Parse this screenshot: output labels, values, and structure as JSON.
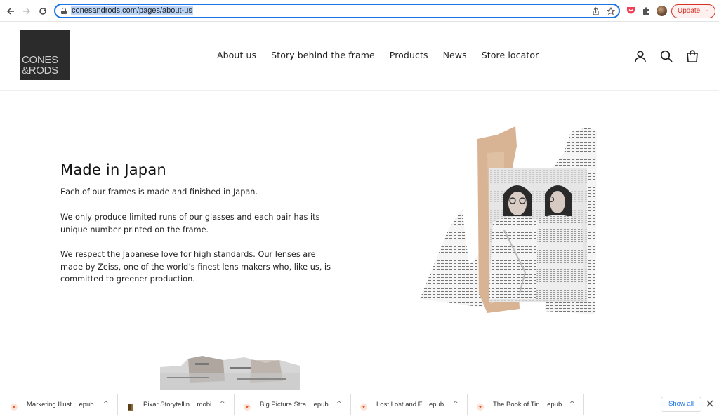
{
  "browser": {
    "url": "conesandrods.com/pages/about-us",
    "update_label": "Update",
    "menu_glyph": "⋮"
  },
  "site": {
    "logo_line1": "CONES",
    "logo_line2": "&RODS",
    "nav": [
      "About us",
      "Story behind the frame",
      "Products",
      "News",
      "Store locator"
    ]
  },
  "main": {
    "heading": "Made in Japan",
    "paragraphs": [
      "Each of our frames is made and finished in Japan.",
      "We only produce limited runs of our glasses and each pair has its unique number printed on the frame.",
      "We respect the Japanese love for high standards. Our lenses are made by Zeiss, one of the world’s finest lens makers who, like us, is committed to greener production."
    ]
  },
  "downloads": {
    "items": [
      {
        "label": "Marketing Illust....epub",
        "icon": "epub-icon"
      },
      {
        "label": "Pixar Storytellin....mobi",
        "icon": "mobi-icon"
      },
      {
        "label": "Big Picture Stra....epub",
        "icon": "epub-icon"
      },
      {
        "label": "Lost Lost and F....epub",
        "icon": "epub-icon"
      },
      {
        "label": "The Book of Tin....epub",
        "icon": "epub-icon"
      }
    ],
    "show_all_label": "Show all"
  },
  "colors": {
    "accent": "#1a73e8",
    "update_red": "#d93025",
    "logo_bg": "#2b2b2b"
  }
}
